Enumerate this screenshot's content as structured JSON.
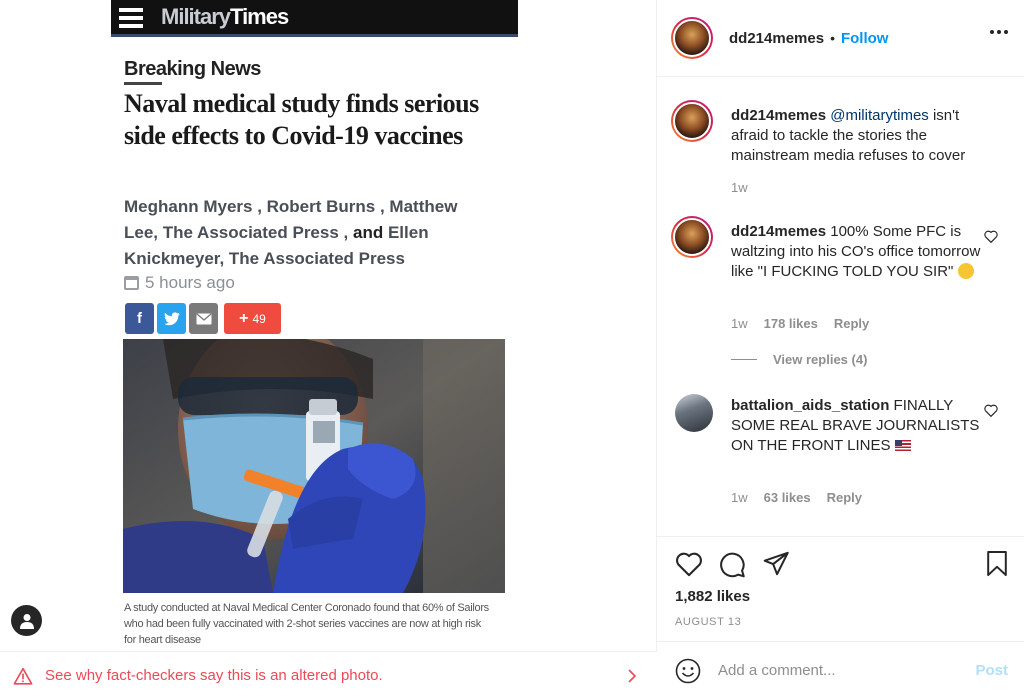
{
  "article": {
    "site_logo_part1": "Military",
    "site_logo_part2": "Times",
    "kicker": "Breaking News",
    "headline": "Naval medical study finds serious side effects to Covid-19 vaccines",
    "byline_part1": "Meghann Myers , Robert Burns , Matthew Lee, The Associated Press ,",
    "byline_and": "and",
    "byline_part2": "Ellen Knickmeyer, The Associated Press",
    "dateline": "5 hours ago",
    "share_fb": "f",
    "share_count": "49",
    "caption": "A study conducted at Naval Medical Center Coronado found that 60% of Sailors who had been fully vaccinated with 2-shot series vaccines are now at high risk for heart disease"
  },
  "fact_check": {
    "text": "See why fact-checkers say this is an altered photo."
  },
  "post_header": {
    "username": "dd214memes",
    "dot": "•",
    "follow_label": "Follow"
  },
  "comments": [
    {
      "username": "dd214memes",
      "mention": "@militarytimes",
      "text": "isn't afraid to tackle the stories the mainstream media refuses to cover",
      "time": "1w"
    },
    {
      "username": "dd214memes",
      "text": "100% Some PFC is waltzing into his CO's office tomorrow like \"I FUCKING TOLD YOU SIR\"",
      "time": "1w",
      "likes": "178 likes",
      "reply_label": "Reply",
      "view_replies": "View replies (4)"
    },
    {
      "username": "battalion_aids_station",
      "text": "FINALLY SOME REAL BRAVE JOURNALISTS ON THE FRONT LINES",
      "time": "1w",
      "likes": "63 likes",
      "reply_label": "Reply"
    }
  ],
  "actions": {
    "likes": "1,882 likes",
    "date": "AUGUST 13"
  },
  "add_comment": {
    "placeholder": "Add a comment...",
    "post_label": "Post"
  },
  "colors": {
    "accent_blue": "#0095f6",
    "warning_red": "#ed4956",
    "muted": "#8e8e8e"
  },
  "icons": [
    "menu-icon",
    "calendar-icon",
    "warning-icon",
    "chevron-right-icon",
    "heart-icon",
    "comment-icon",
    "share-icon",
    "bookmark-icon",
    "emoji-icon",
    "more-options-icon",
    "user-icon"
  ]
}
